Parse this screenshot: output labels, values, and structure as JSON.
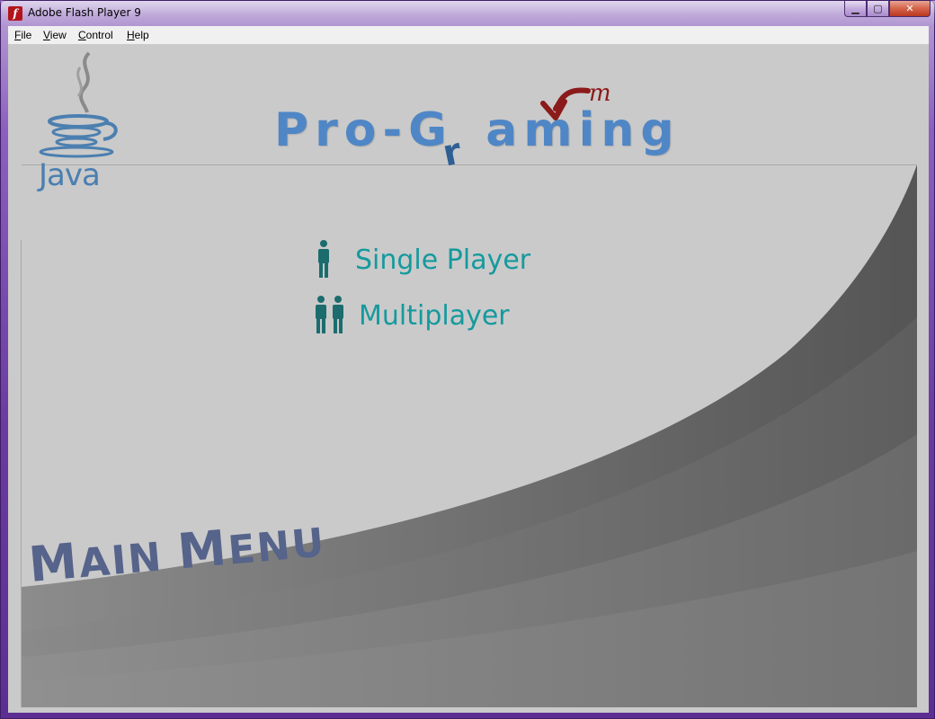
{
  "window": {
    "title": "Adobe Flash Player 9",
    "icon": "flash-icon",
    "controls": {
      "minimize": "minimize-icon",
      "maximize": "maximize-icon",
      "close": "close-icon"
    }
  },
  "menubar": {
    "items": [
      {
        "label": "File",
        "accel": "F",
        "rest": "ile"
      },
      {
        "label": "View",
        "accel": "V",
        "rest": "iew"
      },
      {
        "label": "Control",
        "accel": "C",
        "rest": "ontrol"
      },
      {
        "label": "Help",
        "accel": "H",
        "rest": "elp"
      }
    ]
  },
  "content": {
    "java_logo_text": "Java",
    "brand": {
      "text": "Pro-G",
      "text2": "aming",
      "overlay_r": "r",
      "overlay_m": "m"
    },
    "options": [
      {
        "label": "Single Player",
        "icon": "single-person-icon"
      },
      {
        "label": "Multiplayer",
        "icon": "two-persons-icon"
      }
    ],
    "section_title": {
      "first_cap": "M",
      "first_rest": "AIN",
      "second_cap": "M",
      "second_rest": "ENU"
    }
  },
  "colors": {
    "option_text": "#149a9e",
    "brand_blue": "#4f86c6",
    "brand_red": "#8b1a1a",
    "stage_bg": "#cacaca",
    "section_title": "#56638a"
  }
}
